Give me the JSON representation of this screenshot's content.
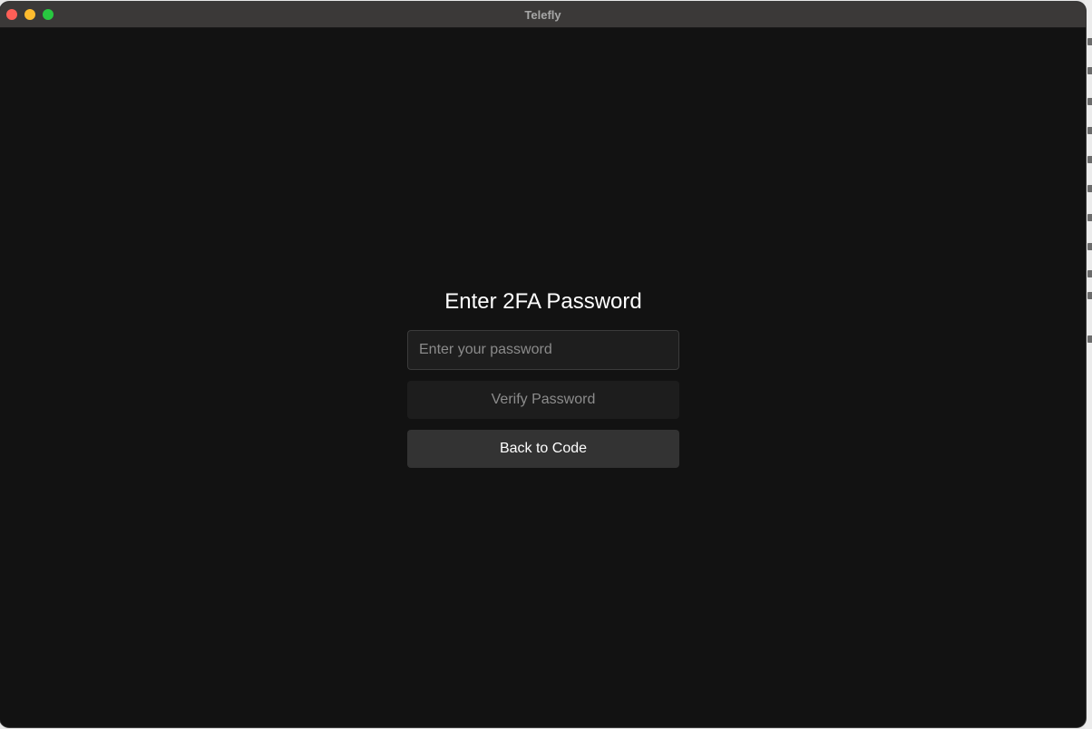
{
  "window": {
    "title": "Telefly"
  },
  "auth": {
    "heading": "Enter 2FA Password",
    "password_placeholder": "Enter your password",
    "password_value": "",
    "verify_label": "Verify Password",
    "back_label": "Back to Code"
  },
  "colors": {
    "background": "#121212",
    "titlebar": "#3b3938",
    "input_background": "#1e1e1e",
    "verify_button": "#1d1d1d",
    "back_button": "#333333",
    "close_dot": "#fe5f57",
    "minimize_dot": "#febc2e",
    "zoom_dot": "#28c840"
  }
}
